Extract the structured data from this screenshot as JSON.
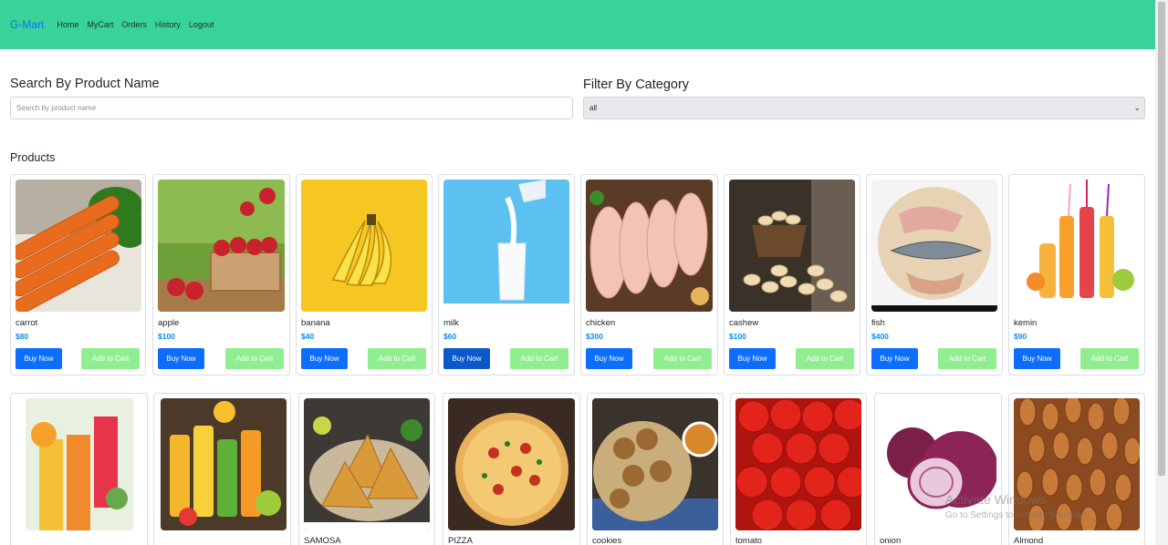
{
  "navbar": {
    "brand": "G-Mart",
    "links": [
      "Home",
      "MyCart",
      "Orders",
      "History",
      "Logout"
    ]
  },
  "search": {
    "label": "Search By Product Name",
    "placeholder": "Search by product name"
  },
  "filter": {
    "label": "Filter By Category",
    "selected": "all"
  },
  "products_title": "Products",
  "buttons": {
    "buy": "Buy Now",
    "add": "Add to Cart"
  },
  "row1": [
    {
      "name": "carrot",
      "price": "$80"
    },
    {
      "name": "apple",
      "price": "$100"
    },
    {
      "name": "banana",
      "price": "$40"
    },
    {
      "name": "milk",
      "price": "$60"
    },
    {
      "name": "chicken",
      "price": "$300"
    },
    {
      "name": "cashew",
      "price": "$100"
    },
    {
      "name": "fish",
      "price": "$400"
    },
    {
      "name": "kemin",
      "price": "$90"
    }
  ],
  "row2": [
    {
      "name": ""
    },
    {
      "name": ""
    },
    {
      "name": "SAMOSA"
    },
    {
      "name": "PIZZA"
    },
    {
      "name": "cookies"
    },
    {
      "name": "tomato"
    },
    {
      "name": "onion"
    },
    {
      "name": "Almond"
    }
  ],
  "watermark": {
    "line1": "Activate Windows",
    "line2": "Go to Settings to activate Windows."
  }
}
